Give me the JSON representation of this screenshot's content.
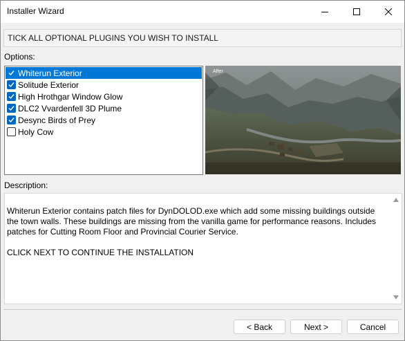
{
  "window": {
    "title": "Installer Wizard"
  },
  "header": {
    "instruction": "TICK ALL OPTIONAL PLUGINS YOU WISH TO INSTALL"
  },
  "options": {
    "label": "Options:",
    "items": [
      {
        "label": "Whiterun Exterior",
        "checked": true,
        "selected": true
      },
      {
        "label": "Solitude Exterior",
        "checked": true,
        "selected": false
      },
      {
        "label": "High Hrothgar Window Glow",
        "checked": true,
        "selected": false
      },
      {
        "label": "DLC2 Vvardenfell 3D Plume",
        "checked": true,
        "selected": false
      },
      {
        "label": "Desync Birds of Prey",
        "checked": true,
        "selected": false
      },
      {
        "label": "Holy Cow",
        "checked": false,
        "selected": false
      }
    ]
  },
  "preview": {
    "caption": "After"
  },
  "description": {
    "label": "Description:",
    "text": "Whiterun Exterior contains patch files for DynDOLOD.exe which add some missing buildings outside the town walls. These buildings are missing from the vanilla game for performance reasons. Includes patches for Cutting Room Floor and Provincial Courier Service.",
    "footer": "CLICK NEXT TO CONTINUE THE INSTALLATION"
  },
  "buttons": {
    "back": "< Back",
    "next": "Next >",
    "cancel": "Cancel"
  },
  "colors": {
    "selection": "#0078d7",
    "checkbox": "#0067c0"
  }
}
